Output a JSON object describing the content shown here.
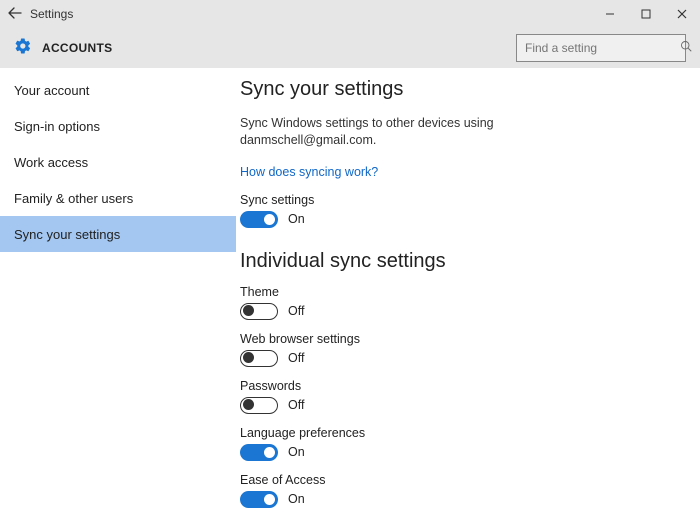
{
  "window": {
    "title": "Settings"
  },
  "header": {
    "title": "ACCOUNTS",
    "search_placeholder": "Find a setting"
  },
  "sidebar": {
    "items": [
      {
        "label": "Your account"
      },
      {
        "label": "Sign-in options"
      },
      {
        "label": "Work access"
      },
      {
        "label": "Family & other users"
      },
      {
        "label": "Sync your settings"
      }
    ],
    "selected_index": 4
  },
  "main": {
    "title": "Sync your settings",
    "description": "Sync Windows settings to other devices using danmschell@gmail.com.",
    "help_link": "How does syncing work?",
    "master": {
      "label": "Sync settings",
      "state": true,
      "state_label": "On"
    },
    "section_title": "Individual sync settings",
    "items": [
      {
        "label": "Theme",
        "state": false,
        "state_label": "Off"
      },
      {
        "label": "Web browser settings",
        "state": false,
        "state_label": "Off"
      },
      {
        "label": "Passwords",
        "state": false,
        "state_label": "Off"
      },
      {
        "label": "Language preferences",
        "state": true,
        "state_label": "On"
      },
      {
        "label": "Ease of Access",
        "state": true,
        "state_label": "On"
      }
    ]
  }
}
